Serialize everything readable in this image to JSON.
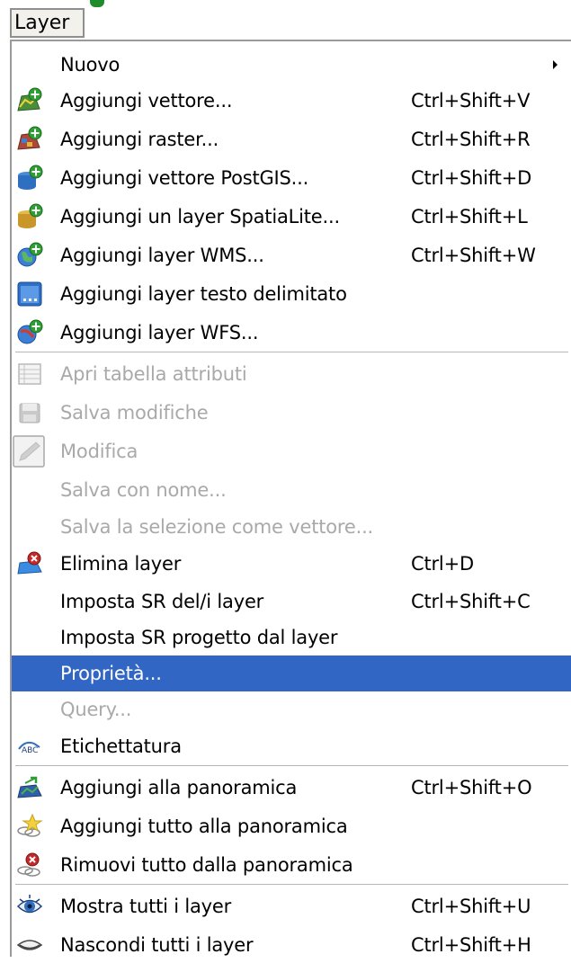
{
  "menubar": {
    "menu_label": "Layer"
  },
  "menu": {
    "items": [
      {
        "label": "Nuovo",
        "shortcut": "",
        "icon": "",
        "submenu": true,
        "state": "enabled"
      },
      {
        "label": "Aggiungi vettore...",
        "shortcut": "Ctrl+Shift+V",
        "icon": "add-vector-icon",
        "state": "enabled"
      },
      {
        "label": "Aggiungi raster...",
        "shortcut": "Ctrl+Shift+R",
        "icon": "add-raster-icon",
        "state": "enabled"
      },
      {
        "label": "Aggiungi vettore PostGIS...",
        "shortcut": "Ctrl+Shift+D",
        "icon": "add-postgis-icon",
        "state": "enabled"
      },
      {
        "label": "Aggiungi un layer SpatiaLite...",
        "shortcut": "Ctrl+Shift+L",
        "icon": "add-spatialite-icon",
        "state": "enabled"
      },
      {
        "label": "Aggiungi layer WMS...",
        "shortcut": "Ctrl+Shift+W",
        "icon": "add-wms-icon",
        "state": "enabled"
      },
      {
        "label": "Aggiungi layer testo delimitato",
        "shortcut": "",
        "icon": "delimited-text-icon",
        "state": "enabled"
      },
      {
        "label": "Aggiungi layer WFS...",
        "shortcut": "",
        "icon": "add-wfs-icon",
        "state": "enabled"
      },
      {
        "label": "Apri tabella attributi",
        "shortcut": "",
        "icon": "attribute-table-icon",
        "state": "disabled"
      },
      {
        "label": "Salva modifiche",
        "shortcut": "",
        "icon": "save-edits-icon",
        "state": "disabled"
      },
      {
        "label": "Modifica",
        "shortcut": "",
        "icon": "edit-pencil-icon",
        "state": "disabled"
      },
      {
        "label": "Salva con nome...",
        "shortcut": "",
        "icon": "",
        "state": "disabled"
      },
      {
        "label": "Salva la selezione come vettore...",
        "shortcut": "",
        "icon": "",
        "state": "disabled"
      },
      {
        "label": "Elimina layer",
        "shortcut": "Ctrl+D",
        "icon": "remove-layer-icon",
        "state": "enabled"
      },
      {
        "label": "Imposta SR del/i layer",
        "shortcut": "Ctrl+Shift+C",
        "icon": "",
        "state": "enabled"
      },
      {
        "label": "Imposta SR progetto dal layer",
        "shortcut": "",
        "icon": "",
        "state": "enabled"
      },
      {
        "label": "Proprietà...",
        "shortcut": "",
        "icon": "",
        "state": "highlighted"
      },
      {
        "label": "Query...",
        "shortcut": "",
        "icon": "",
        "state": "disabled"
      },
      {
        "label": "Etichettatura",
        "shortcut": "",
        "icon": "labeling-icon",
        "state": "enabled"
      },
      {
        "label": "Aggiungi alla panoramica",
        "shortcut": "Ctrl+Shift+O",
        "icon": "add-to-overview-icon",
        "state": "enabled"
      },
      {
        "label": "Aggiungi tutto alla panoramica",
        "shortcut": "",
        "icon": "add-all-overview-icon",
        "state": "enabled"
      },
      {
        "label": "Rimuovi tutto dalla panoramica",
        "shortcut": "",
        "icon": "remove-all-overview-icon",
        "state": "enabled"
      },
      {
        "label": "Mostra tutti i layer",
        "shortcut": "Ctrl+Shift+U",
        "icon": "show-all-layers-icon",
        "state": "enabled"
      },
      {
        "label": "Nascondi tutti i layer",
        "shortcut": "Ctrl+Shift+H",
        "icon": "hide-all-layers-icon",
        "state": "enabled"
      }
    ]
  },
  "colors": {
    "highlight": "#3166c4",
    "disabled_text": "#a9a9a9",
    "menu_bg": "#ffffff"
  }
}
